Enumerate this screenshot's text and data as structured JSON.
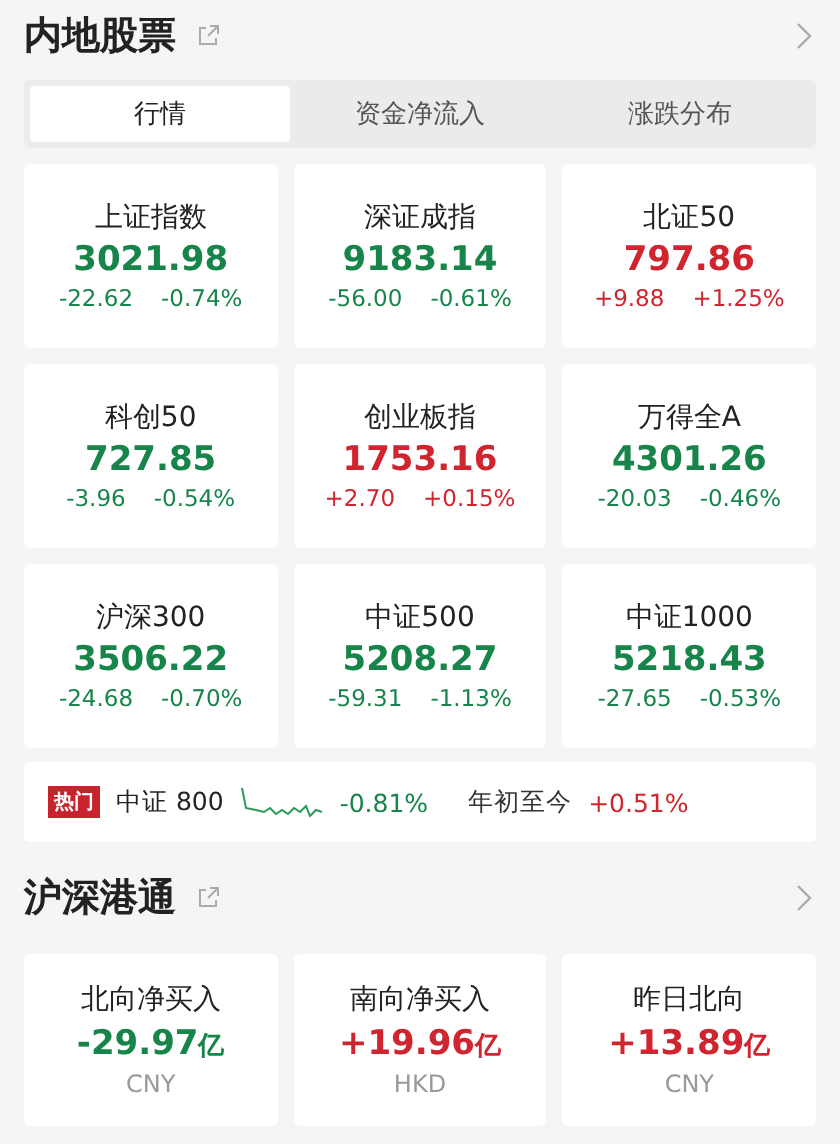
{
  "sections": [
    {
      "title": "内地股票",
      "tabs": [
        {
          "label": "行情",
          "selected": true
        },
        {
          "label": "资金净流入",
          "selected": false
        },
        {
          "label": "涨跌分布",
          "selected": false
        }
      ],
      "indices": [
        {
          "name": "上证指数",
          "value": "3021.98",
          "change": "-22.62",
          "pct": "-0.74%",
          "color": "#17854a"
        },
        {
          "name": "深证成指",
          "value": "9183.14",
          "change": "-56.00",
          "pct": "-0.61%",
          "color": "#17854a"
        },
        {
          "name": "北证50",
          "value": "797.86",
          "change": "+9.88",
          "pct": "+1.25%",
          "color": "#d0242f"
        },
        {
          "name": "科创50",
          "value": "727.85",
          "change": "-3.96",
          "pct": "-0.54%",
          "color": "#17854a"
        },
        {
          "name": "创业板指",
          "value": "1753.16",
          "change": "+2.70",
          "pct": "+0.15%",
          "color": "#d0242f"
        },
        {
          "name": "万得全A",
          "value": "4301.26",
          "change": "-20.03",
          "pct": "-0.46%",
          "color": "#17854a"
        },
        {
          "name": "沪深300",
          "value": "3506.22",
          "change": "-24.68",
          "pct": "-0.70%",
          "color": "#17854a"
        },
        {
          "name": "中证500",
          "value": "5208.27",
          "change": "-59.31",
          "pct": "-1.13%",
          "color": "#17854a"
        },
        {
          "name": "中证1000",
          "value": "5218.43",
          "change": "-27.65",
          "pct": "-0.53%",
          "color": "#17854a"
        }
      ],
      "hot": {
        "badge": "热门",
        "name": "中证 800",
        "change": {
          "text": "-0.81%",
          "color": "#17854a"
        },
        "ytd": {
          "label": "年初至今",
          "text": "+0.51%",
          "color": "#d0242f"
        }
      }
    },
    {
      "title": "沪深港通",
      "flows": [
        {
          "name": "北向净买入",
          "value": "-29.97",
          "unit": "亿",
          "currency": "CNY",
          "color": "#17854a"
        },
        {
          "name": "南向净买入",
          "value": "+19.96",
          "unit": "亿",
          "currency": "HKD",
          "color": "#d0242f"
        },
        {
          "name": "昨日北向",
          "value": "+13.89",
          "unit": "亿",
          "currency": "CNY",
          "color": "#d0242f"
        }
      ]
    }
  ]
}
